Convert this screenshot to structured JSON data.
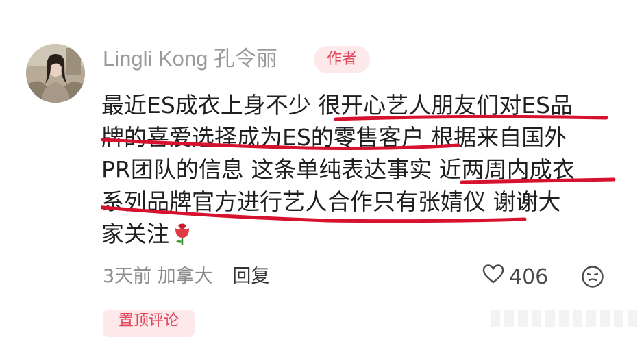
{
  "author": {
    "name": "Lingli Kong 孔令丽",
    "badge": "作者",
    "avatar_icon": "avatar-photo"
  },
  "comment": {
    "lines": [
      "最近ES成衣上身不少 很开心艺人朋友们对ES品",
      "牌的喜爱选择成为ES的零售客户 根据来自国外",
      "PR团队的信息 这条单纯表达事实 近两周内成衣",
      "系列品牌官方进行艺人合作只有张婧仪 谢谢大",
      "家关注"
    ],
    "emoji_icon": "rose-icon",
    "underline_color": "#d6122e"
  },
  "meta": {
    "time": "3天前",
    "location": "加拿大",
    "reply_label": "回复",
    "likes": "406"
  },
  "pinned_label": "置顶评论",
  "colors": {
    "badge_bg": "#fde8ea",
    "badge_text": "#e0455a"
  }
}
